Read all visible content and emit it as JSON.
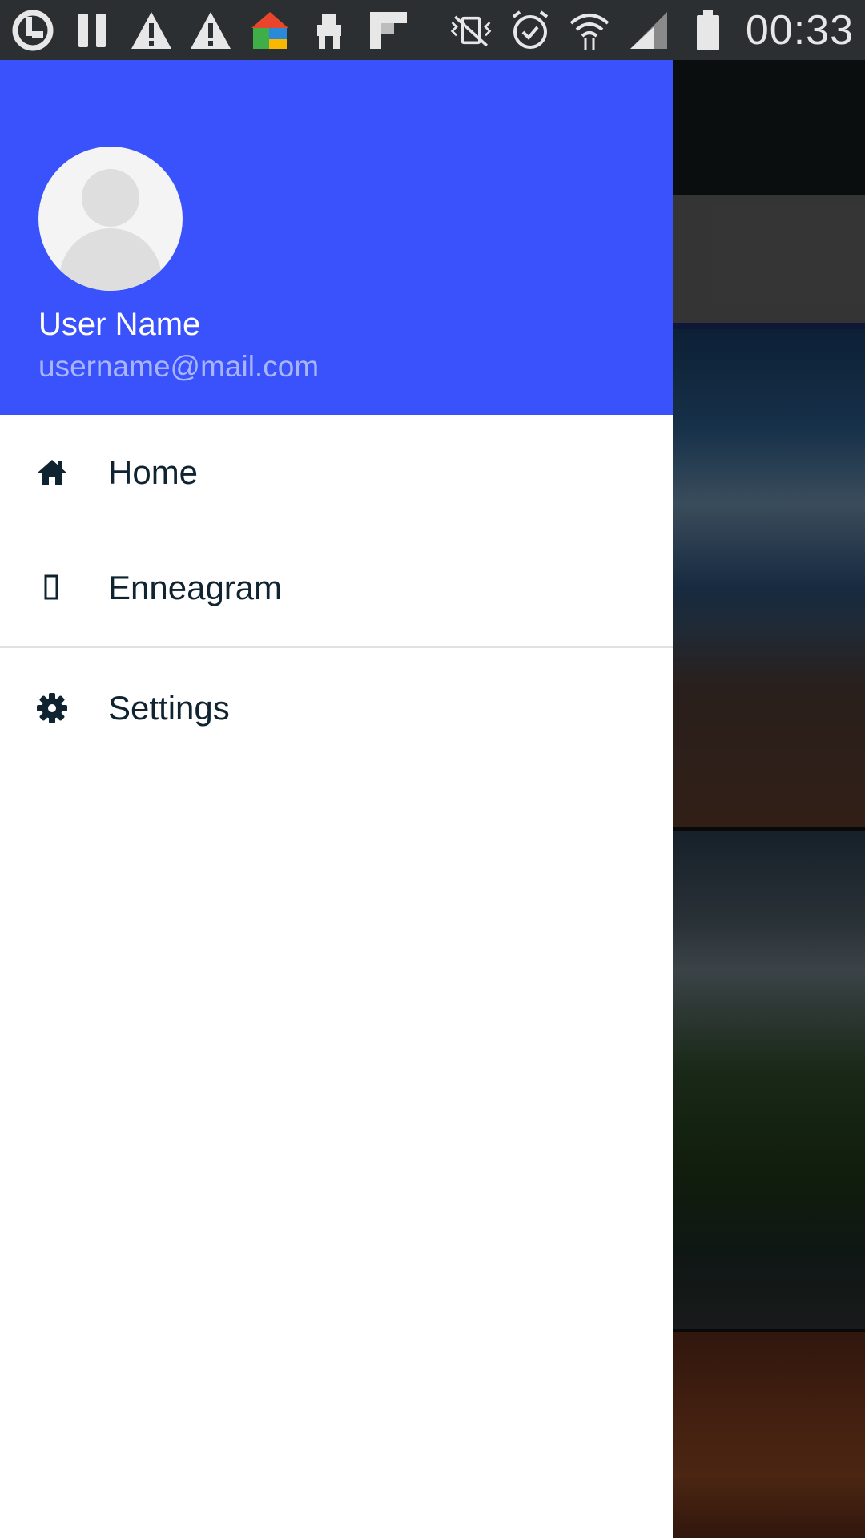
{
  "status_bar": {
    "time": "00:33",
    "left_icons": [
      "uplay-icon",
      "pause-icon",
      "warning-icon",
      "warning-icon",
      "launcher-icon",
      "robot-icon",
      "flipboard-icon"
    ],
    "right_icons": [
      "vibrate-icon",
      "alarm-icon",
      "wifi-icon",
      "signal-icon",
      "battery-icon"
    ]
  },
  "drawer": {
    "header_color": "#3a52fb",
    "user_name": "User Name",
    "user_email": "username@mail.com",
    "items": [
      {
        "label": "Home",
        "icon": "home-icon"
      },
      {
        "label": "Enneagram",
        "icon": "enneagram-icon"
      }
    ],
    "secondary_items": [
      {
        "label": "Settings",
        "icon": "gear-icon"
      }
    ]
  },
  "background_app": {
    "search_icon": "star-search-icon"
  }
}
